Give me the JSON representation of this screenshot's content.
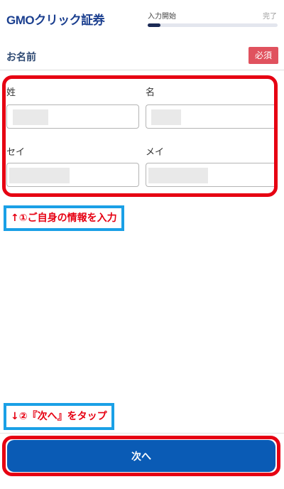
{
  "header": {
    "logo": "GMOクリック証券",
    "progress": {
      "start_label": "入力開始",
      "end_label": "完了",
      "fraction": 0.1
    }
  },
  "section": {
    "title": "お名前",
    "required_badge": "必須"
  },
  "fields": {
    "last_name": {
      "label": "姓",
      "value": ""
    },
    "first_name": {
      "label": "名",
      "value": ""
    },
    "last_name_kana": {
      "label": "セイ",
      "value": ""
    },
    "first_name_kana": {
      "label": "メイ",
      "value": ""
    }
  },
  "annotations": {
    "step1": "↑①ご自身の情報を入力",
    "step2": "↓②『次へ』をタップ"
  },
  "footer": {
    "next_label": "次へ"
  },
  "colors": {
    "accent": "#0a5bb5",
    "highlight": "#e60012",
    "annotation_border": "#1aa0e6",
    "badge": "#e0525e"
  }
}
